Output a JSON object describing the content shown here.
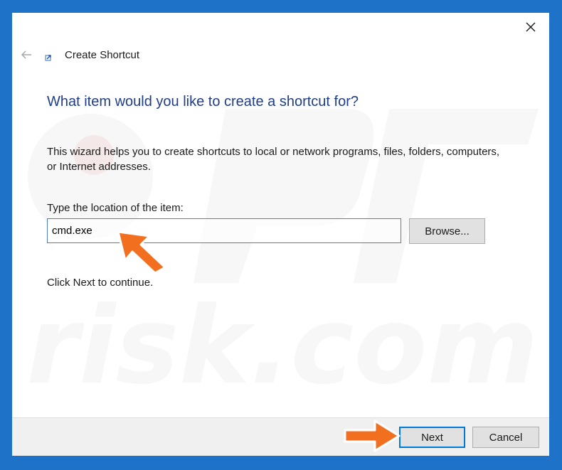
{
  "window": {
    "title": "Create Shortcut",
    "close_icon": "close-icon",
    "back_icon": "back-arrow-icon"
  },
  "content": {
    "heading": "What item would you like to create a shortcut for?",
    "description": "This wizard helps you to create shortcuts to local or network programs, files, folders, computers, or Internet addresses.",
    "location_label": "Type the location of the item:",
    "location_value": "cmd.exe",
    "browse_label": "Browse...",
    "continue_text": "Click Next to continue."
  },
  "footer": {
    "next_label": "Next",
    "cancel_label": "Cancel"
  },
  "colors": {
    "frame": "#1e73c8",
    "heading": "#1f3d8a",
    "annotation_arrow": "#f26f1f",
    "watermark": "#c2c2c2"
  }
}
